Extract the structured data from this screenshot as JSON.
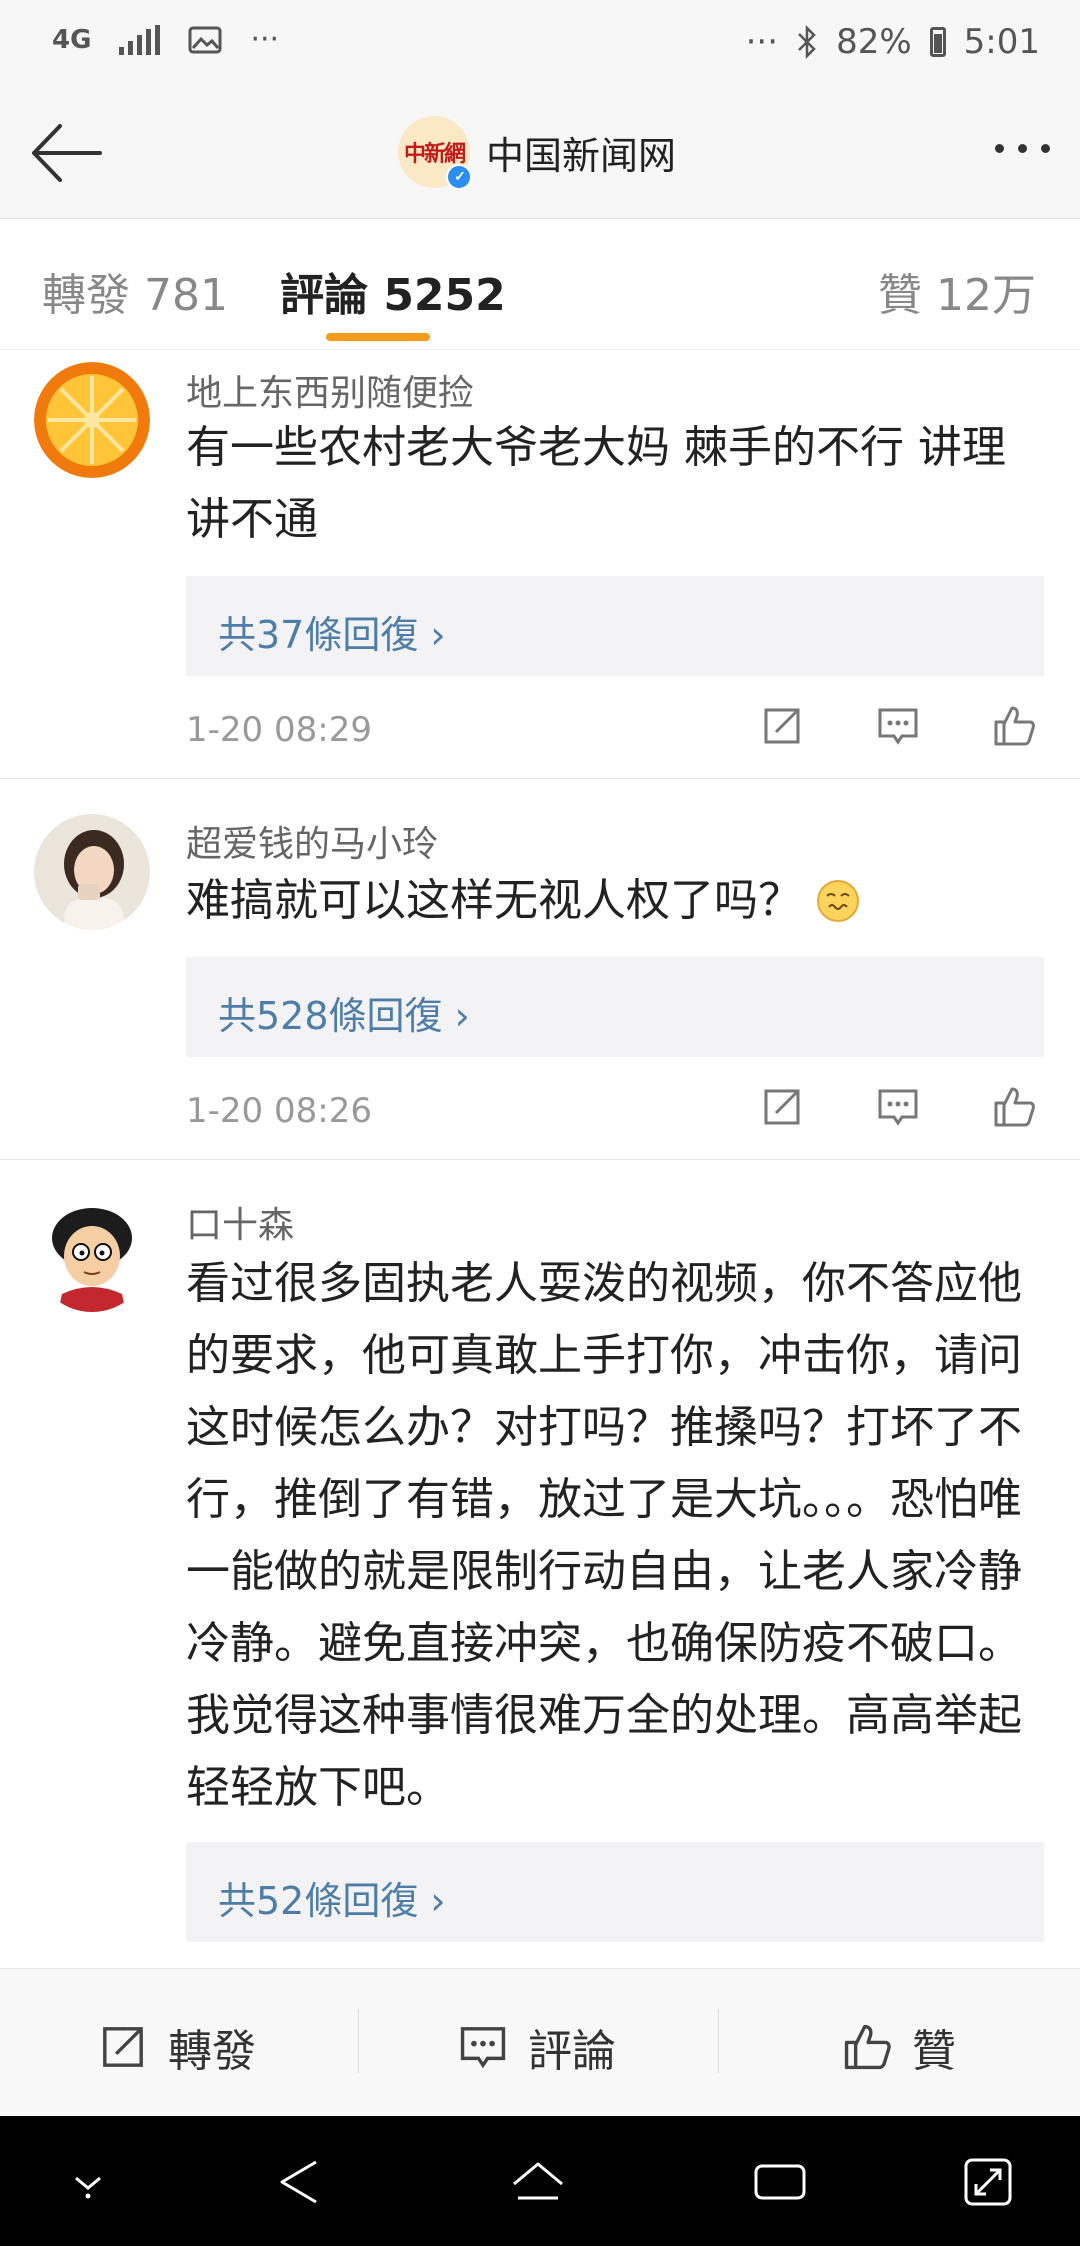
{
  "status_bar": {
    "network": "4G",
    "battery": "82%",
    "time": "5:01",
    "icons": [
      "network-4g-icon",
      "signal-icon",
      "image-icon",
      "more-dots-icon",
      "bluetooth-icon",
      "battery-icon"
    ]
  },
  "header": {
    "account_name": "中国新闻网",
    "logo_text": "中新網",
    "verified": true
  },
  "tabs": {
    "repost": "轉發 781",
    "comments": "評論 5252",
    "likes": "贊 12万",
    "active": "comments",
    "accent_color": "#f29b1d"
  },
  "comments": [
    {
      "user": "地上东西别随便捡",
      "text": "有一些农村老大爷老大妈 棘手的不行 讲理讲不通",
      "replies": "共37條回復 ›",
      "time": "1-20 08:29"
    },
    {
      "user": "超爱钱的马小玲",
      "text": "难搞就可以这样无视人权了吗？",
      "emoji": "face-emoji-icon",
      "replies": "共528條回復 ›",
      "time": "1-20 08:26"
    },
    {
      "user": "口十森",
      "text": "看过很多固执老人耍泼的视频，你不答应他的要求，他可真敢上手打你，冲击你，请问这时候怎么办？对打吗？推搡吗？打坏了不行，推倒了有错，放过了是大坑。。。恐怕唯一能做的就是限制行动自由，让老人家冷静冷静。避免直接冲突，也确保防疫不破口。我觉得这种事情很难万全的处理。高高举起轻轻放下吧。",
      "replies": "共52條回復 ›"
    }
  ],
  "toolbar": {
    "repost": "轉發",
    "comment": "評論",
    "like": "贊"
  },
  "colors": {
    "link": "#4e7ea8",
    "reply_bg": "#f3f3f5"
  }
}
